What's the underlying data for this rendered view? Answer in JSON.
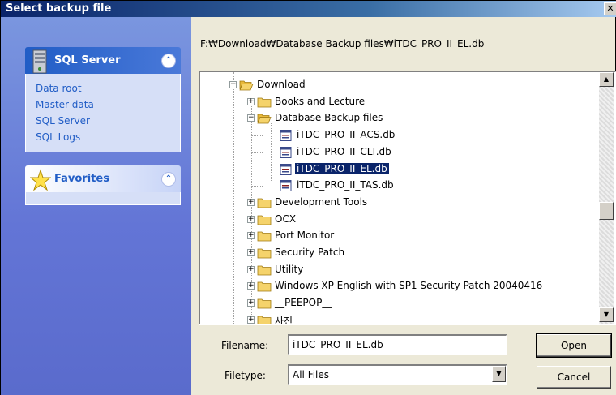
{
  "window": {
    "title": "Select backup file",
    "close_glyph": "✕"
  },
  "sidebar": {
    "groups": [
      {
        "title": "SQL Server",
        "icon": "server-icon",
        "collapse_glyph": "⌃",
        "items": [
          "Data root",
          "Master data",
          "SQL Server",
          "SQL Logs"
        ]
      },
      {
        "title": "Favorites",
        "icon": "star-icon",
        "collapse_glyph": "⌃",
        "items": []
      }
    ]
  },
  "path": "F:₩Download₩Database Backup files₩iTDC_PRO_II_EL.db",
  "tree": {
    "nodes": [
      {
        "label": "Download",
        "type": "folder-open",
        "expander": "−",
        "level": 0
      },
      {
        "label": "Books and Lecture",
        "type": "folder",
        "expander": "+",
        "level": 1
      },
      {
        "label": "Database Backup files",
        "type": "folder-open",
        "expander": "−",
        "level": 1
      },
      {
        "label": "iTDC_PRO_II_ACS.db",
        "type": "file",
        "expander": "",
        "level": 2
      },
      {
        "label": "iTDC_PRO_II_CLT.db",
        "type": "file",
        "expander": "",
        "level": 2
      },
      {
        "label": "iTDC_PRO_II_EL.db",
        "type": "file",
        "expander": "",
        "level": 2,
        "selected": true
      },
      {
        "label": "iTDC_PRO_II_TAS.db",
        "type": "file",
        "expander": "",
        "level": 2
      },
      {
        "label": "Development Tools",
        "type": "folder",
        "expander": "+",
        "level": 1
      },
      {
        "label": "OCX",
        "type": "folder",
        "expander": "+",
        "level": 1
      },
      {
        "label": "Port Monitor",
        "type": "folder",
        "expander": "+",
        "level": 1
      },
      {
        "label": "Security Patch",
        "type": "folder",
        "expander": "+",
        "level": 1
      },
      {
        "label": "Utility",
        "type": "folder",
        "expander": "+",
        "level": 1
      },
      {
        "label": "Windows XP English with SP1 Security Patch 20040416",
        "type": "folder",
        "expander": "+",
        "level": 1
      },
      {
        "label": "__PEEPOP__",
        "type": "folder",
        "expander": "+",
        "level": 1
      },
      {
        "label": "사진",
        "type": "folder",
        "expander": "+",
        "level": 1
      }
    ]
  },
  "scrollbar": {
    "up_glyph": "▲",
    "down_glyph": "▼"
  },
  "form": {
    "filename_label": "Filename:",
    "filename_value": "iTDC_PRO_II_EL.db",
    "filetype_label": "Filetype:",
    "filetype_value": "All Files",
    "dropdown_glyph": "▼"
  },
  "buttons": {
    "open": "Open",
    "cancel": "Cancel"
  },
  "colors": {
    "titlebar": "#0a246a",
    "sidebar": "#6375d6",
    "selection": "#0a246a",
    "folder": "#f5d36b"
  }
}
